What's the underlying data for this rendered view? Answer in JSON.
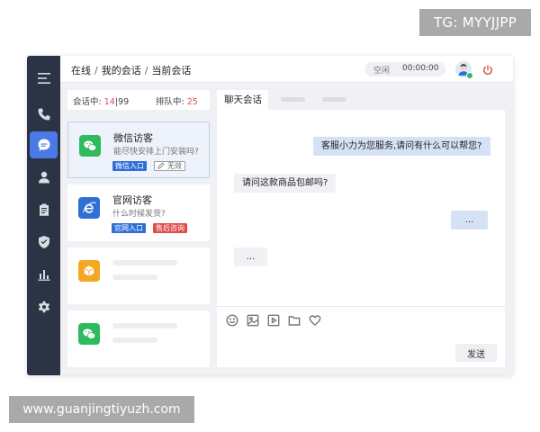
{
  "watermarks": {
    "top": "TG: MYYJJPP",
    "bottom": "www.guanjingtiyuzh.com"
  },
  "breadcrumb": [
    "在线",
    "我的会话",
    "当前会话"
  ],
  "status": {
    "state": "空闲",
    "timer": "00:00:00"
  },
  "sidebar": {
    "items": [
      {
        "icon": "menu-icon"
      },
      {
        "icon": "phone-icon"
      },
      {
        "icon": "chat-bubble-icon",
        "active": true
      },
      {
        "icon": "user-icon"
      },
      {
        "icon": "clipboard-icon"
      },
      {
        "icon": "shield-icon"
      },
      {
        "icon": "bar-chart-icon"
      },
      {
        "icon": "gear-icon"
      }
    ]
  },
  "queue": {
    "in_session_label": "会话中:",
    "in_session_count": "14",
    "in_session_total": "99",
    "queued_label": "排队中:",
    "queued_count": "25"
  },
  "sessions": [
    {
      "title": "微信访客",
      "preview": "能尽快安排上门安装吗?",
      "tags": [
        "微信入口",
        "无效"
      ],
      "icon": "wechat-icon",
      "color": "#2dbb5d",
      "active": true
    },
    {
      "title": "官网访客",
      "preview": "什么时候发货?",
      "tags": [
        "官网入口",
        "售后咨询"
      ],
      "icon": "ie-icon",
      "color": "#2f6fd6"
    },
    {
      "icon": "cube-icon",
      "color": "#f5a623"
    },
    {
      "icon": "wechat-icon",
      "color": "#2dbb5d"
    }
  ],
  "chat": {
    "tab_label": "聊天会话",
    "messages": [
      {
        "from": "agent",
        "text": "客服小力为您服务,请问有什么可以帮您?"
      },
      {
        "from": "guest",
        "text": "请问这款商品包邮吗?"
      },
      {
        "from": "agent",
        "text": "..."
      },
      {
        "from": "guest",
        "text": "..."
      }
    ],
    "tools": [
      "emoji-icon",
      "image-icon",
      "video-icon",
      "folder-icon",
      "heart-icon"
    ],
    "send_label": "发送"
  }
}
